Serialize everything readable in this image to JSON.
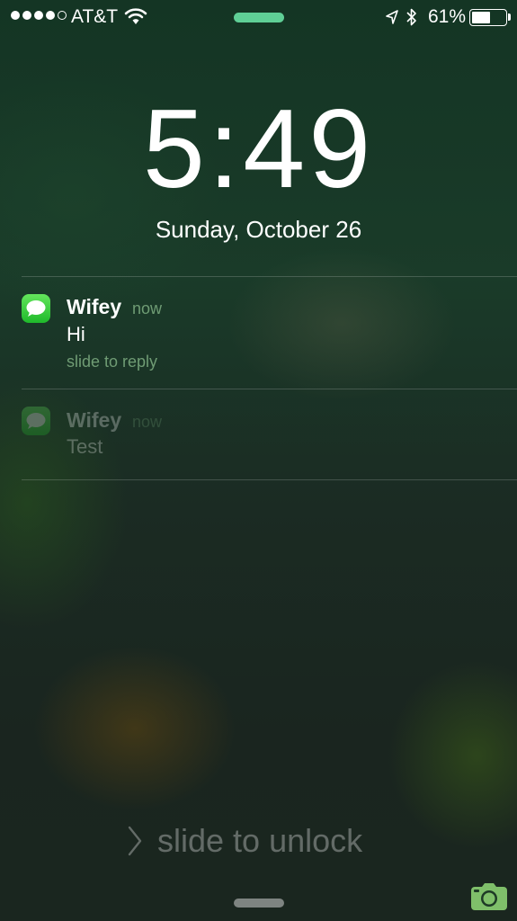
{
  "status_bar": {
    "carrier": "AT&T",
    "signal_bars": 4,
    "signal_max": 5,
    "battery_percent": "61%",
    "battery_level": 0.61,
    "icons": [
      "signal-dots-icon",
      "wifi-icon",
      "location-arrow-icon",
      "bluetooth-icon",
      "battery-icon"
    ]
  },
  "lockscreen": {
    "time": "5:49",
    "date": "Sunday, October 26",
    "unlock_text": "slide to unlock"
  },
  "notifications": [
    {
      "app_icon": "messages-icon",
      "sender": "Wifey",
      "time": "now",
      "message": "Hi",
      "action": "slide to reply"
    },
    {
      "app_icon": "messages-icon",
      "sender": "Wifey",
      "time": "now",
      "message": "Test"
    }
  ],
  "colors": {
    "accent_green": "#5fcf96",
    "messages_green": "#34c83e",
    "secondary_text": "#6f9c74"
  }
}
